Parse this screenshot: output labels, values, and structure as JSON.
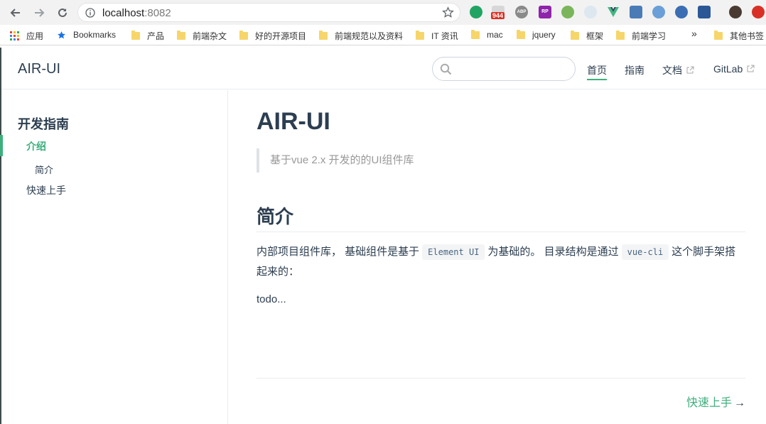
{
  "browser": {
    "url_host": "localhost",
    "url_port": ":8082",
    "mail_badge": "944",
    "ext_rp_label": "RP",
    "ext_abp_label": "ABP"
  },
  "bookmarks": {
    "apps": "应用",
    "items": [
      "Bookmarks",
      "产品",
      "前端杂文",
      "好的开源项目",
      "前端规范以及资料",
      "IT 资讯",
      "mac",
      "jquery",
      "框架",
      "前端学习"
    ],
    "overflow": "»",
    "other": "其他书签"
  },
  "site": {
    "title": "AIR-UI",
    "nav": [
      "首页",
      "指南",
      "文档",
      "GitLab"
    ]
  },
  "sidebar": {
    "heading": "开发指南",
    "active_item": "介绍",
    "sub_item": "简介",
    "item": "快速上手"
  },
  "content": {
    "title": "AIR-UI",
    "quote": "基于vue 2.x 开发的的UI组件库",
    "section_title": "简介",
    "para_part1": "内部项目组件库， 基础组件是基于",
    "code1": "Element UI",
    "para_part2": "为基础的。 目录结构是通过",
    "code2": "vue-cli",
    "para_part3": "这个脚手架搭起来的：",
    "todo": "todo...",
    "next_label": "快速上手",
    "next_arrow": "→"
  },
  "colors": {
    "accent": "#3eaf7c",
    "text": "#2c3e50"
  }
}
